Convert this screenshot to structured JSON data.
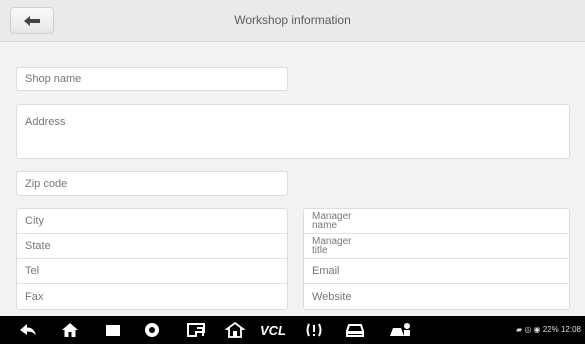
{
  "header": {
    "title": "Workshop information"
  },
  "fields": {
    "shop_name": "Shop name",
    "address": "Address",
    "zip_code": "Zip code"
  },
  "left_table": [
    "City",
    "State",
    "Tel",
    "Fax"
  ],
  "right_table": {
    "manager_name": [
      "Manager",
      "name"
    ],
    "manager_title": [
      "Manager",
      "title"
    ],
    "email": "Email",
    "website": "Website"
  },
  "nav": {
    "vcl_label": "VCL",
    "status": "22% 12:08"
  },
  "colors": {
    "navbar": "#000000",
    "background": "#f2f2f2"
  }
}
